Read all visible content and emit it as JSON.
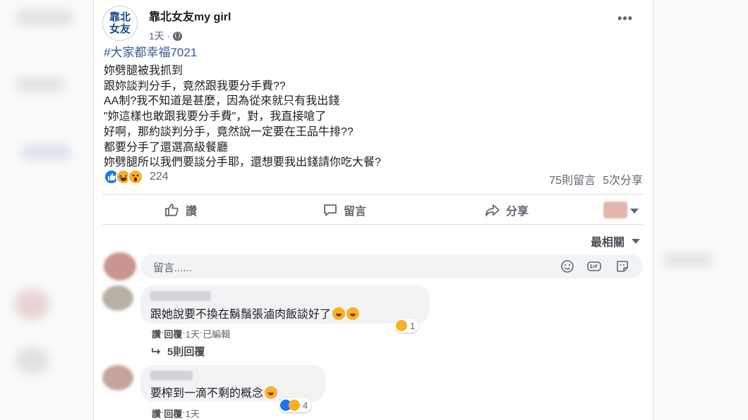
{
  "post": {
    "page_name": "靠北女友my girl",
    "avatar_line1": "靠北",
    "avatar_line2": "女友",
    "time": "1天",
    "dot": "·",
    "more": "•••",
    "hashtag": "#大家都幸福7021",
    "lines": [
      "妳劈腿被我抓到",
      "跟妳談判分手，竟然跟我要分手費??",
      "AA制?我不知道是甚麼，因為從來就只有我出錢",
      "\"妳這樣也敢跟我要分手費\"，對，我直接嗆了",
      "好啊，那約談判分手，竟然說一定要在王品牛排??",
      "都要分手了還選高級餐廳",
      "妳劈腿所以我們要談分手耶，還想要我出錢請你吃大餐?"
    ],
    "reaction_count": "224",
    "comments_count": "75則留言",
    "shares_count": "5次分享"
  },
  "actions": {
    "like": "讚",
    "comment": "留言",
    "share": "分享"
  },
  "sort": {
    "label": "最相關"
  },
  "composer": {
    "placeholder": "留言......"
  },
  "comments": [
    {
      "text": "跟她說要不換在鬍鬚張滷肉飯談好了",
      "reaction_count": "1",
      "like": "讚",
      "reply": "回覆",
      "time": "1天",
      "edited": "已編輯",
      "sep": " · ",
      "replies_label": "5則回覆"
    },
    {
      "text": "要榨到一滴不剩的概念",
      "reaction_count": "4",
      "like": "讚",
      "reply": "回覆",
      "time": "1天",
      "sep": " · "
    }
  ],
  "colors": {
    "link_blue": "#385898",
    "like_blue": "#1877f2",
    "haha_yellow": "#f7b125",
    "text_gray": "#606770"
  }
}
